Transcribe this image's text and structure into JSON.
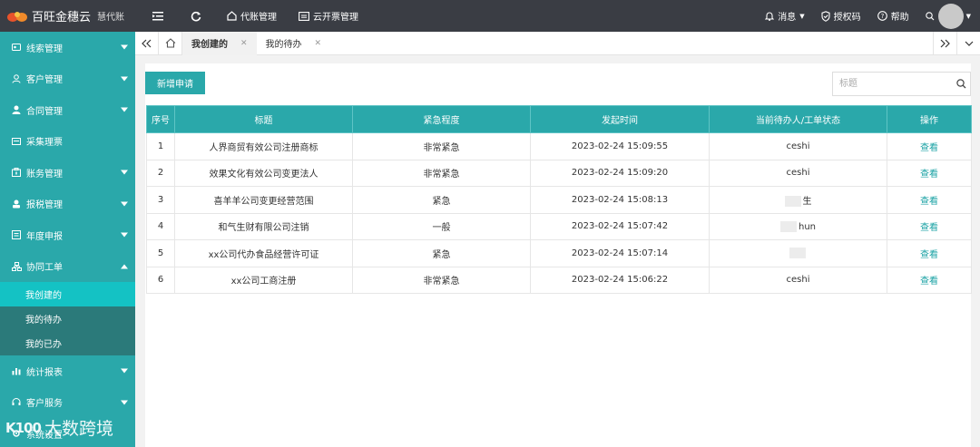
{
  "app": {
    "name": "百旺金穗云",
    "sub": "慧代账"
  },
  "topbar": {
    "left": [
      {
        "label": "代账管理",
        "icon": "home-icon"
      },
      {
        "label": "云开票管理",
        "icon": "invoice-icon"
      }
    ],
    "right": [
      {
        "label": "消息",
        "icon": "bell-icon"
      },
      {
        "label": "授权码",
        "icon": "shield-icon"
      },
      {
        "label": "帮助",
        "icon": "help-icon"
      }
    ]
  },
  "sidebar": {
    "items": [
      {
        "label": "线索管理",
        "icon": "lead-icon",
        "caret": "down"
      },
      {
        "label": "客户管理",
        "icon": "customer-icon",
        "caret": "down"
      },
      {
        "label": "合同管理",
        "icon": "contract-icon",
        "caret": "down"
      },
      {
        "label": "采集理票",
        "icon": "collect-icon",
        "caret": ""
      },
      {
        "label": "账务管理",
        "icon": "accounting-icon",
        "caret": "down"
      },
      {
        "label": "报税管理",
        "icon": "tax-icon",
        "caret": "down"
      },
      {
        "label": "年度申报",
        "icon": "annual-icon",
        "caret": "down"
      },
      {
        "label": "协同工单",
        "icon": "workflow-icon",
        "caret": "up"
      }
    ],
    "sub_items": [
      {
        "label": "我创建的",
        "active": true
      },
      {
        "label": "我的待办",
        "active": false
      },
      {
        "label": "我的已办",
        "active": false
      }
    ],
    "items_after": [
      {
        "label": "统计报表",
        "icon": "stats-icon",
        "caret": "down"
      },
      {
        "label": "客户服务",
        "icon": "service-icon",
        "caret": "down"
      },
      {
        "label": "系统设置",
        "icon": "settings-icon",
        "caret": "down"
      }
    ]
  },
  "tabs": [
    {
      "label": "我创建的",
      "active": true
    },
    {
      "label": "我的待办",
      "active": false
    }
  ],
  "toolbar": {
    "new_label": "新增申请",
    "search_placeholder": "标题"
  },
  "table": {
    "headers": [
      "序号",
      "标题",
      "紧急程度",
      "发起时间",
      "当前待办人/工单状态",
      "操作"
    ],
    "rows": [
      {
        "no": "1",
        "title": "人界商贸有效公司注册商标",
        "urgency": "非常紧急",
        "time": "2023-02-24 15:09:55",
        "assignee": "ceshi",
        "action": "查看"
      },
      {
        "no": "2",
        "title": "效果文化有效公司变更法人",
        "urgency": "非常紧急",
        "time": "2023-02-24 15:09:20",
        "assignee": "ceshi",
        "action": "查看"
      },
      {
        "no": "3",
        "title": "喜羊羊公司变更经营范围",
        "urgency": "紧急",
        "time": "2023-02-24 15:08:13",
        "assignee": "生",
        "action": "查看"
      },
      {
        "no": "4",
        "title": "和气生财有限公司注销",
        "urgency": "一般",
        "time": "2023-02-24 15:07:42",
        "assignee": "hun",
        "action": "查看"
      },
      {
        "no": "5",
        "title": "xx公司代办食品经营许可证",
        "urgency": "紧急",
        "time": "2023-02-24 15:07:14",
        "assignee": "",
        "action": "查看"
      },
      {
        "no": "6",
        "title": "xx公司工商注册",
        "urgency": "非常紧急",
        "time": "2023-02-24 15:06:22",
        "assignee": "ceshi",
        "action": "查看"
      }
    ]
  },
  "watermark": {
    "logo": "K100",
    "text": "大数跨境"
  }
}
